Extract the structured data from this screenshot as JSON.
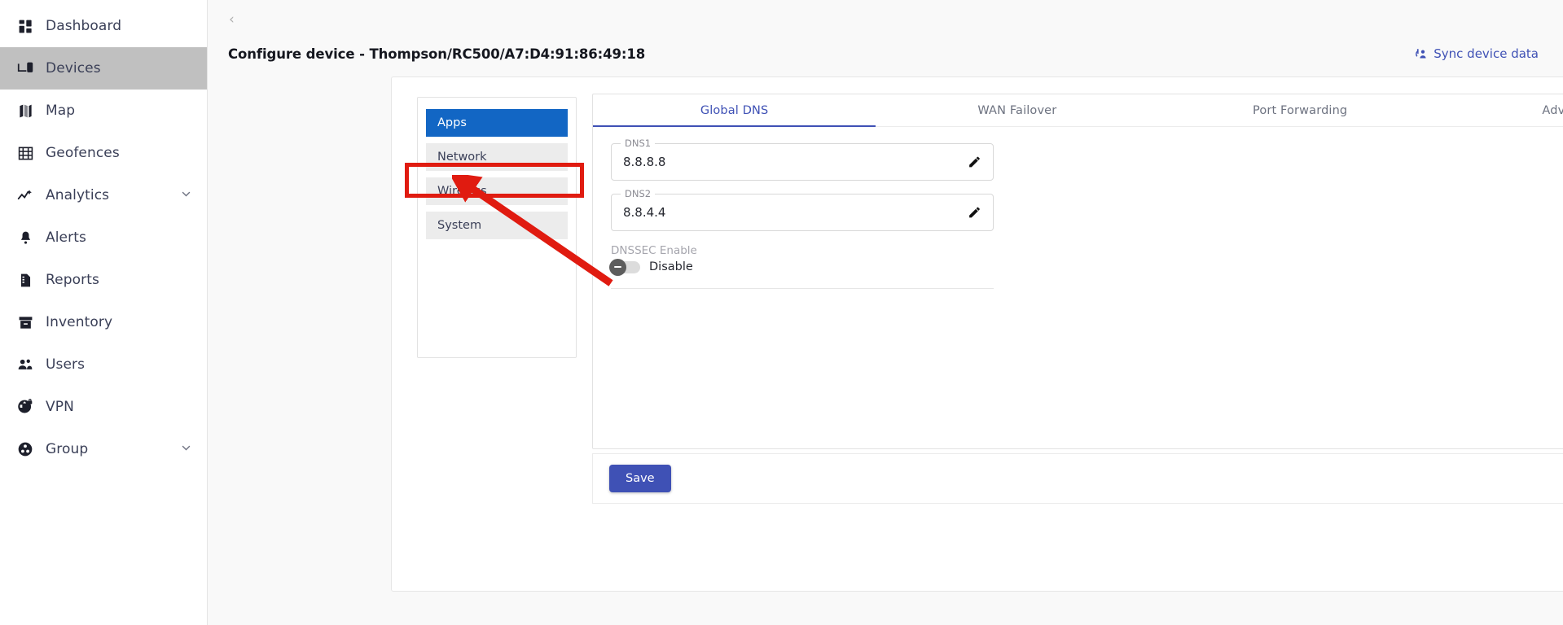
{
  "sidebar": {
    "items": [
      {
        "label": "Dashboard",
        "icon": "dashboard-icon",
        "active": false,
        "expandable": false
      },
      {
        "label": "Devices",
        "icon": "devices-icon",
        "active": true,
        "expandable": false
      },
      {
        "label": "Map",
        "icon": "map-icon",
        "active": false,
        "expandable": false
      },
      {
        "label": "Geofences",
        "icon": "geofence-icon",
        "active": false,
        "expandable": false
      },
      {
        "label": "Analytics",
        "icon": "analytics-icon",
        "active": false,
        "expandable": true
      },
      {
        "label": "Alerts",
        "icon": "bell-icon",
        "active": false,
        "expandable": false
      },
      {
        "label": "Reports",
        "icon": "report-icon",
        "active": false,
        "expandable": false
      },
      {
        "label": "Inventory",
        "icon": "inventory-icon",
        "active": false,
        "expandable": false
      },
      {
        "label": "Users",
        "icon": "users-icon",
        "active": false,
        "expandable": false
      },
      {
        "label": "VPN",
        "icon": "vpn-icon",
        "active": false,
        "expandable": false
      },
      {
        "label": "Group",
        "icon": "group-icon",
        "active": false,
        "expandable": true
      }
    ]
  },
  "header": {
    "back_label": "‹",
    "title": "Configure device - Thompson/RC500/A7:D4:91:86:49:18",
    "sync_label": "Sync device data",
    "sync_icon": "sync-device-icon"
  },
  "submenu": {
    "items": [
      {
        "label": "Apps",
        "active": true
      },
      {
        "label": "Network",
        "active": false
      },
      {
        "label": "Wireless",
        "active": false
      },
      {
        "label": "System",
        "active": false
      }
    ]
  },
  "tabs": [
    {
      "label": "Global DNS",
      "active": true
    },
    {
      "label": "WAN Failover",
      "active": false
    },
    {
      "label": "Port Forwarding",
      "active": false
    },
    {
      "label": "Advance DNS",
      "active": false
    }
  ],
  "form": {
    "dns1": {
      "legend": "DNS1",
      "value": "8.8.8.8",
      "edit_icon": "pencil-icon"
    },
    "dns2": {
      "legend": "DNS2",
      "value": "8.8.4.4",
      "edit_icon": "pencil-icon"
    },
    "dnssec": {
      "caption": "DNSSEC Enable",
      "state_label": "Disable",
      "enabled": false
    },
    "save_label": "Save"
  },
  "colors": {
    "accent_blue": "#3f51b5",
    "submenu_active": "#1266c4",
    "sidebar_active": "#c0c0c0",
    "annotation_red": "#e01b10"
  }
}
